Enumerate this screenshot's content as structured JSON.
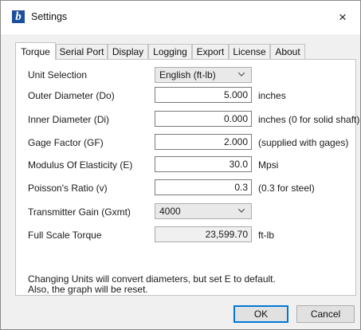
{
  "window": {
    "title": "Settings",
    "app_icon_letter": "b",
    "close_glyph": "×"
  },
  "tabs": [
    {
      "label": "Torque",
      "active": true
    },
    {
      "label": "Serial Port",
      "active": false
    },
    {
      "label": "Display",
      "active": false
    },
    {
      "label": "Logging",
      "active": false
    },
    {
      "label": "Export",
      "active": false
    },
    {
      "label": "License",
      "active": false
    },
    {
      "label": "About",
      "active": false
    }
  ],
  "form": {
    "unit_selection": {
      "label": "Unit Selection",
      "value": "English (ft-lb)"
    },
    "outer_diameter": {
      "label": "Outer Diameter (Do)",
      "value": "5.000",
      "unit": "inches"
    },
    "inner_diameter": {
      "label": "Inner Diameter (Di)",
      "value": "0.000",
      "unit": "inches (0 for solid shaft)"
    },
    "gage_factor": {
      "label": "Gage Factor (GF)",
      "value": "2.000",
      "unit": "(supplied with gages)"
    },
    "modulus": {
      "label": "Modulus Of Elasticity (E)",
      "value": "30.0",
      "unit": "Mpsi"
    },
    "poisson": {
      "label": "Poisson's Ratio (v)",
      "value": "0.3",
      "unit": "(0.3 for steel)"
    },
    "transmitter_gain": {
      "label": "Transmitter Gain (Gxmt)",
      "value": "4000"
    },
    "full_scale_torque": {
      "label": "Full Scale Torque",
      "value": "23,599.70",
      "unit": "ft-lb"
    }
  },
  "note": {
    "line1": "Changing Units will convert diameters, but set E to default.",
    "line2": "Also, the graph will be reset."
  },
  "buttons": {
    "ok": "OK",
    "cancel": "Cancel"
  },
  "colors": {
    "app_icon": "#1c4f9c",
    "default_button_border": "#0078d7"
  },
  "icons": {
    "app": "app-logo-icon",
    "close": "close-icon",
    "dropdown": "chevron-down-icon"
  }
}
